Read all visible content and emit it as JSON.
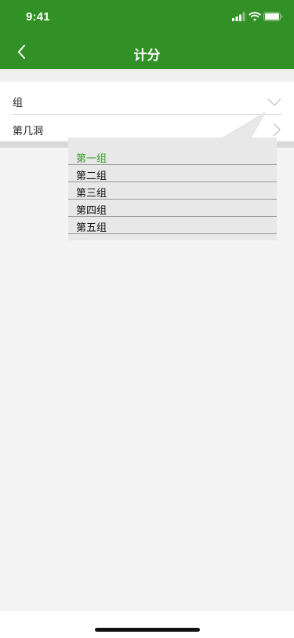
{
  "status_bar": {
    "time": "9:41",
    "icons": [
      "signal-icon",
      "wifi-icon",
      "battery-icon"
    ]
  },
  "header": {
    "title": "计分",
    "back_icon": "chevron-left-icon",
    "background_color": "#329126"
  },
  "form": {
    "group_label": "组",
    "group_icon": "chevron-down-icon",
    "hole_label": "第几洞",
    "hole_icon": "chevron-right-icon"
  },
  "dropdown": {
    "options": [
      "第一组",
      "第二组",
      "第三组",
      "第四组",
      "第五组"
    ],
    "selected": "第一组",
    "selected_color": "#3d9a2c"
  }
}
